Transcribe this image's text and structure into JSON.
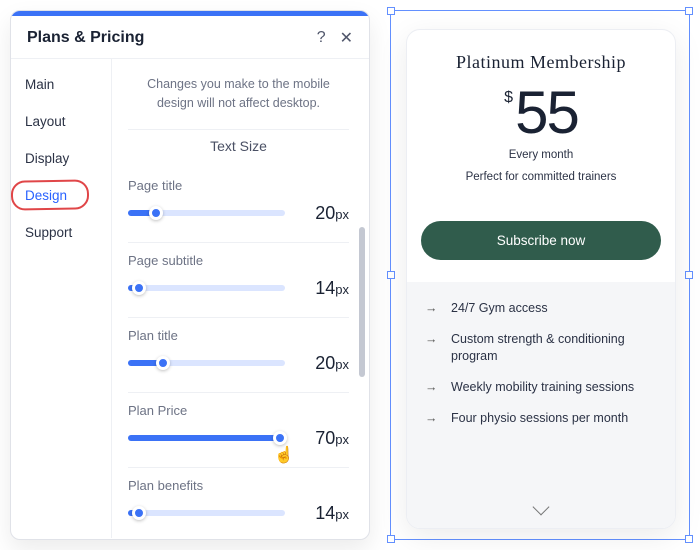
{
  "panel": {
    "title": "Plans & Pricing",
    "sidebar": [
      {
        "label": "Main",
        "active": false
      },
      {
        "label": "Layout",
        "active": false
      },
      {
        "label": "Display",
        "active": false
      },
      {
        "label": "Design",
        "active": true
      },
      {
        "label": "Support",
        "active": false
      }
    ],
    "info": "Changes you make to the mobile design will not affect desktop.",
    "section_title": "Text Size",
    "sliders": [
      {
        "label": "Page title",
        "value": 20,
        "unit": "px",
        "min": 10,
        "max": 72,
        "percent": 18
      },
      {
        "label": "Page subtitle",
        "value": 14,
        "unit": "px",
        "min": 10,
        "max": 72,
        "percent": 7
      },
      {
        "label": "Plan title",
        "value": 20,
        "unit": "px",
        "min": 10,
        "max": 72,
        "percent": 22
      },
      {
        "label": "Plan Price",
        "value": 70,
        "unit": "px",
        "min": 10,
        "max": 72,
        "percent": 97
      },
      {
        "label": "Plan benefits",
        "value": 14,
        "unit": "px",
        "min": 10,
        "max": 72,
        "percent": 7
      }
    ]
  },
  "preview": {
    "card": {
      "title": "Platinum Membership",
      "currency": "$",
      "price": "55",
      "period": "Every month",
      "tagline": "Perfect for committed trainers",
      "cta": "Subscribe now",
      "features": [
        "24/7 Gym access",
        "Custom strength & conditioning program",
        "Weekly mobility training sessions",
        "Four physio sessions per month"
      ]
    }
  }
}
